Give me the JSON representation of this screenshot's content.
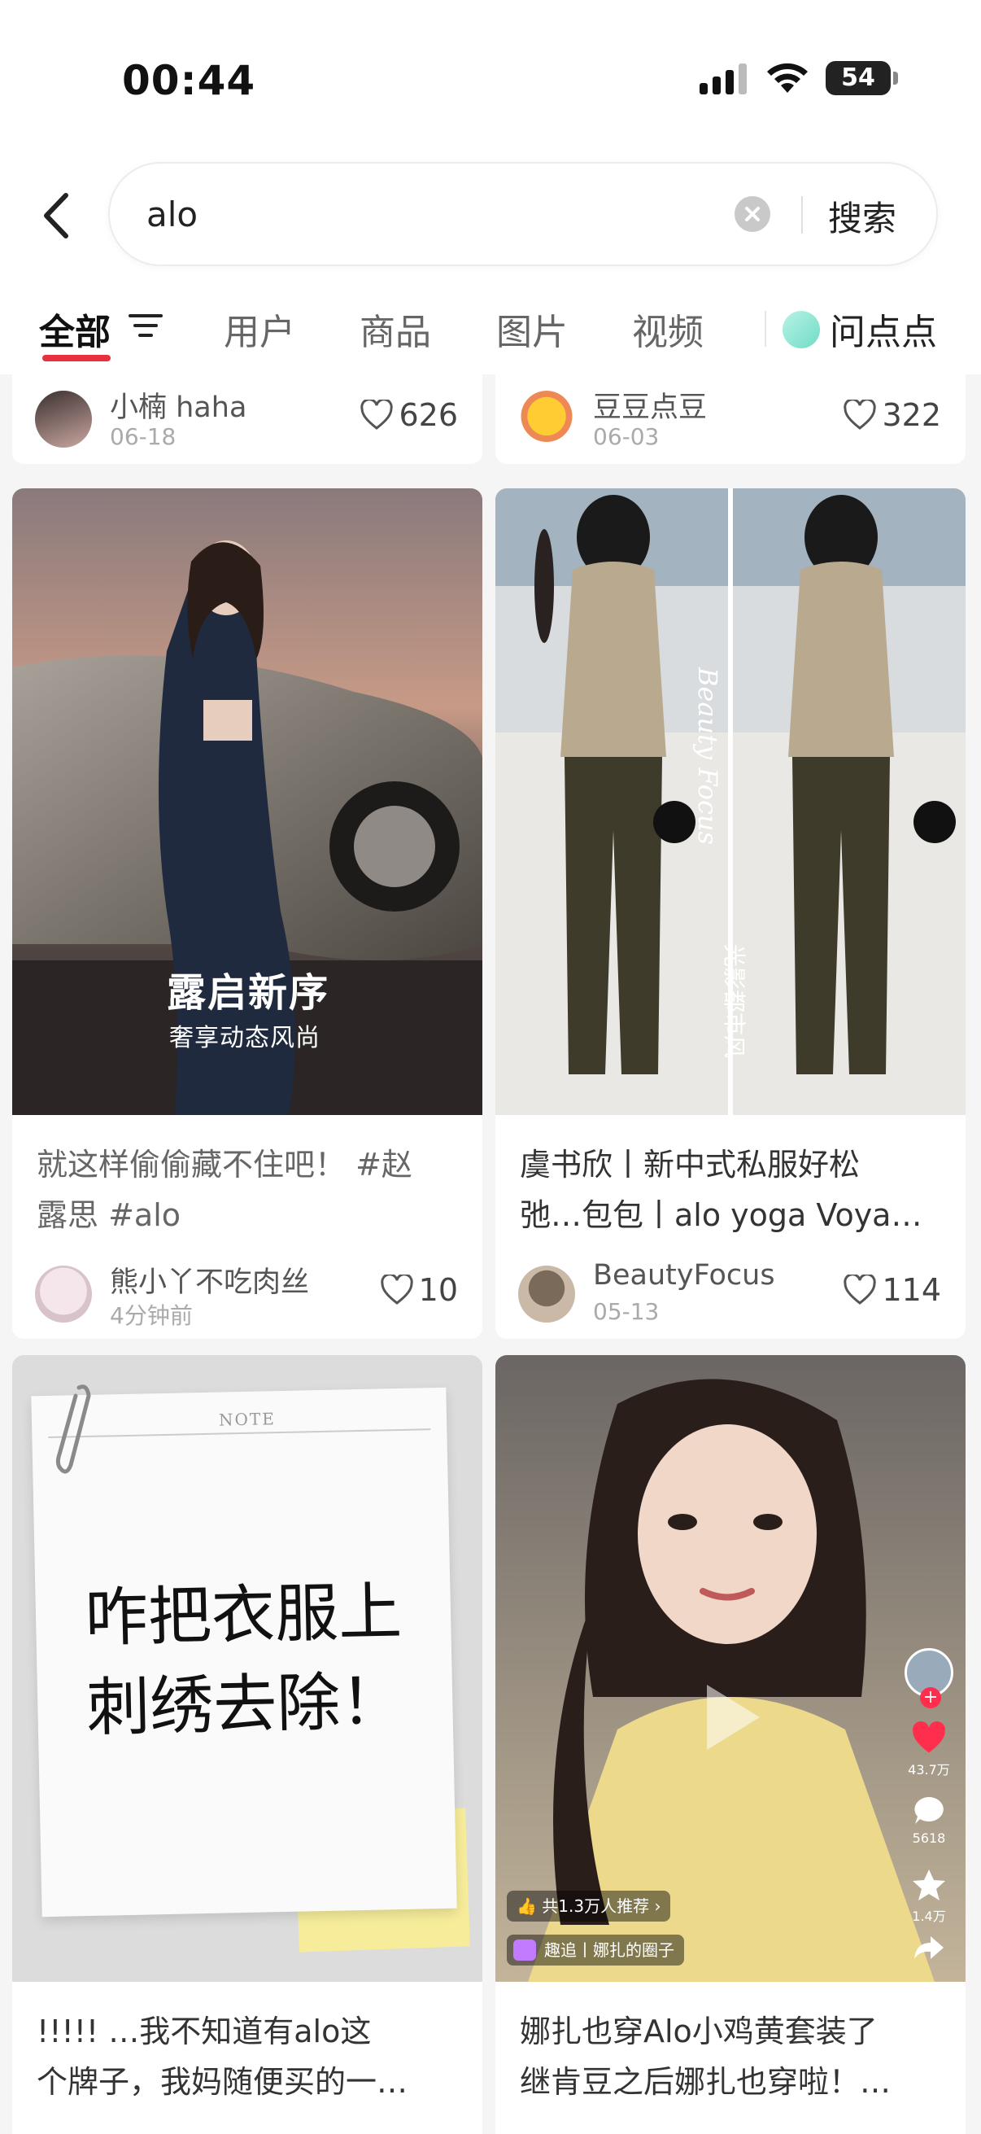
{
  "status_bar": {
    "time": "00:44",
    "battery": "54"
  },
  "search": {
    "query": "alo",
    "button_label": "搜索"
  },
  "tabs": [
    {
      "label": "全部",
      "active": true
    },
    {
      "label": "用户"
    },
    {
      "label": "商品"
    },
    {
      "label": "图片"
    },
    {
      "label": "视频"
    },
    {
      "label": "问点点"
    }
  ],
  "top_row": [
    {
      "author": "小楠 haha",
      "date": "06-18",
      "likes": "626"
    },
    {
      "author": "豆豆点豆",
      "date": "06-03",
      "likes": "322"
    }
  ],
  "cards": [
    {
      "overlay_title": "露启新序",
      "overlay_sub": "奢享动态风尚",
      "title_line1": "就这样偷偷藏不住吧！ #赵",
      "title_line2": "露思 #alo",
      "author": "熊小丫不吃肉丝",
      "date": "4分钟前",
      "likes": "10"
    },
    {
      "watermark": "Beauty Focus",
      "watermark2": "光影都市风",
      "title_line1": "虞书欣丨新中式私服好松",
      "title_line2": "弛…包包丨alo yoga Voya…",
      "author": "BeautyFocus",
      "date": "05-13",
      "likes": "114"
    },
    {
      "note_label": "NOTE",
      "note_line1": "咋把衣服上",
      "note_line2": "刺绣去除！",
      "title_line1": "!!!!! …我不知道有alo这",
      "title_line2": "个牌子，我妈随便买的一…"
    },
    {
      "video_likes": "43.7万",
      "video_comments": "5618",
      "video_stars": "1.4万",
      "recommend": "共1.3万人推荐",
      "circle": "趣追丨娜扎的圈子",
      "title_line1": "娜扎也穿Alo小鸡黄套装了",
      "title_line2": "继肯豆之后娜扎也穿啦！…"
    }
  ],
  "colors": {
    "accent": "#e8303e",
    "background": "#f5f5f5"
  }
}
